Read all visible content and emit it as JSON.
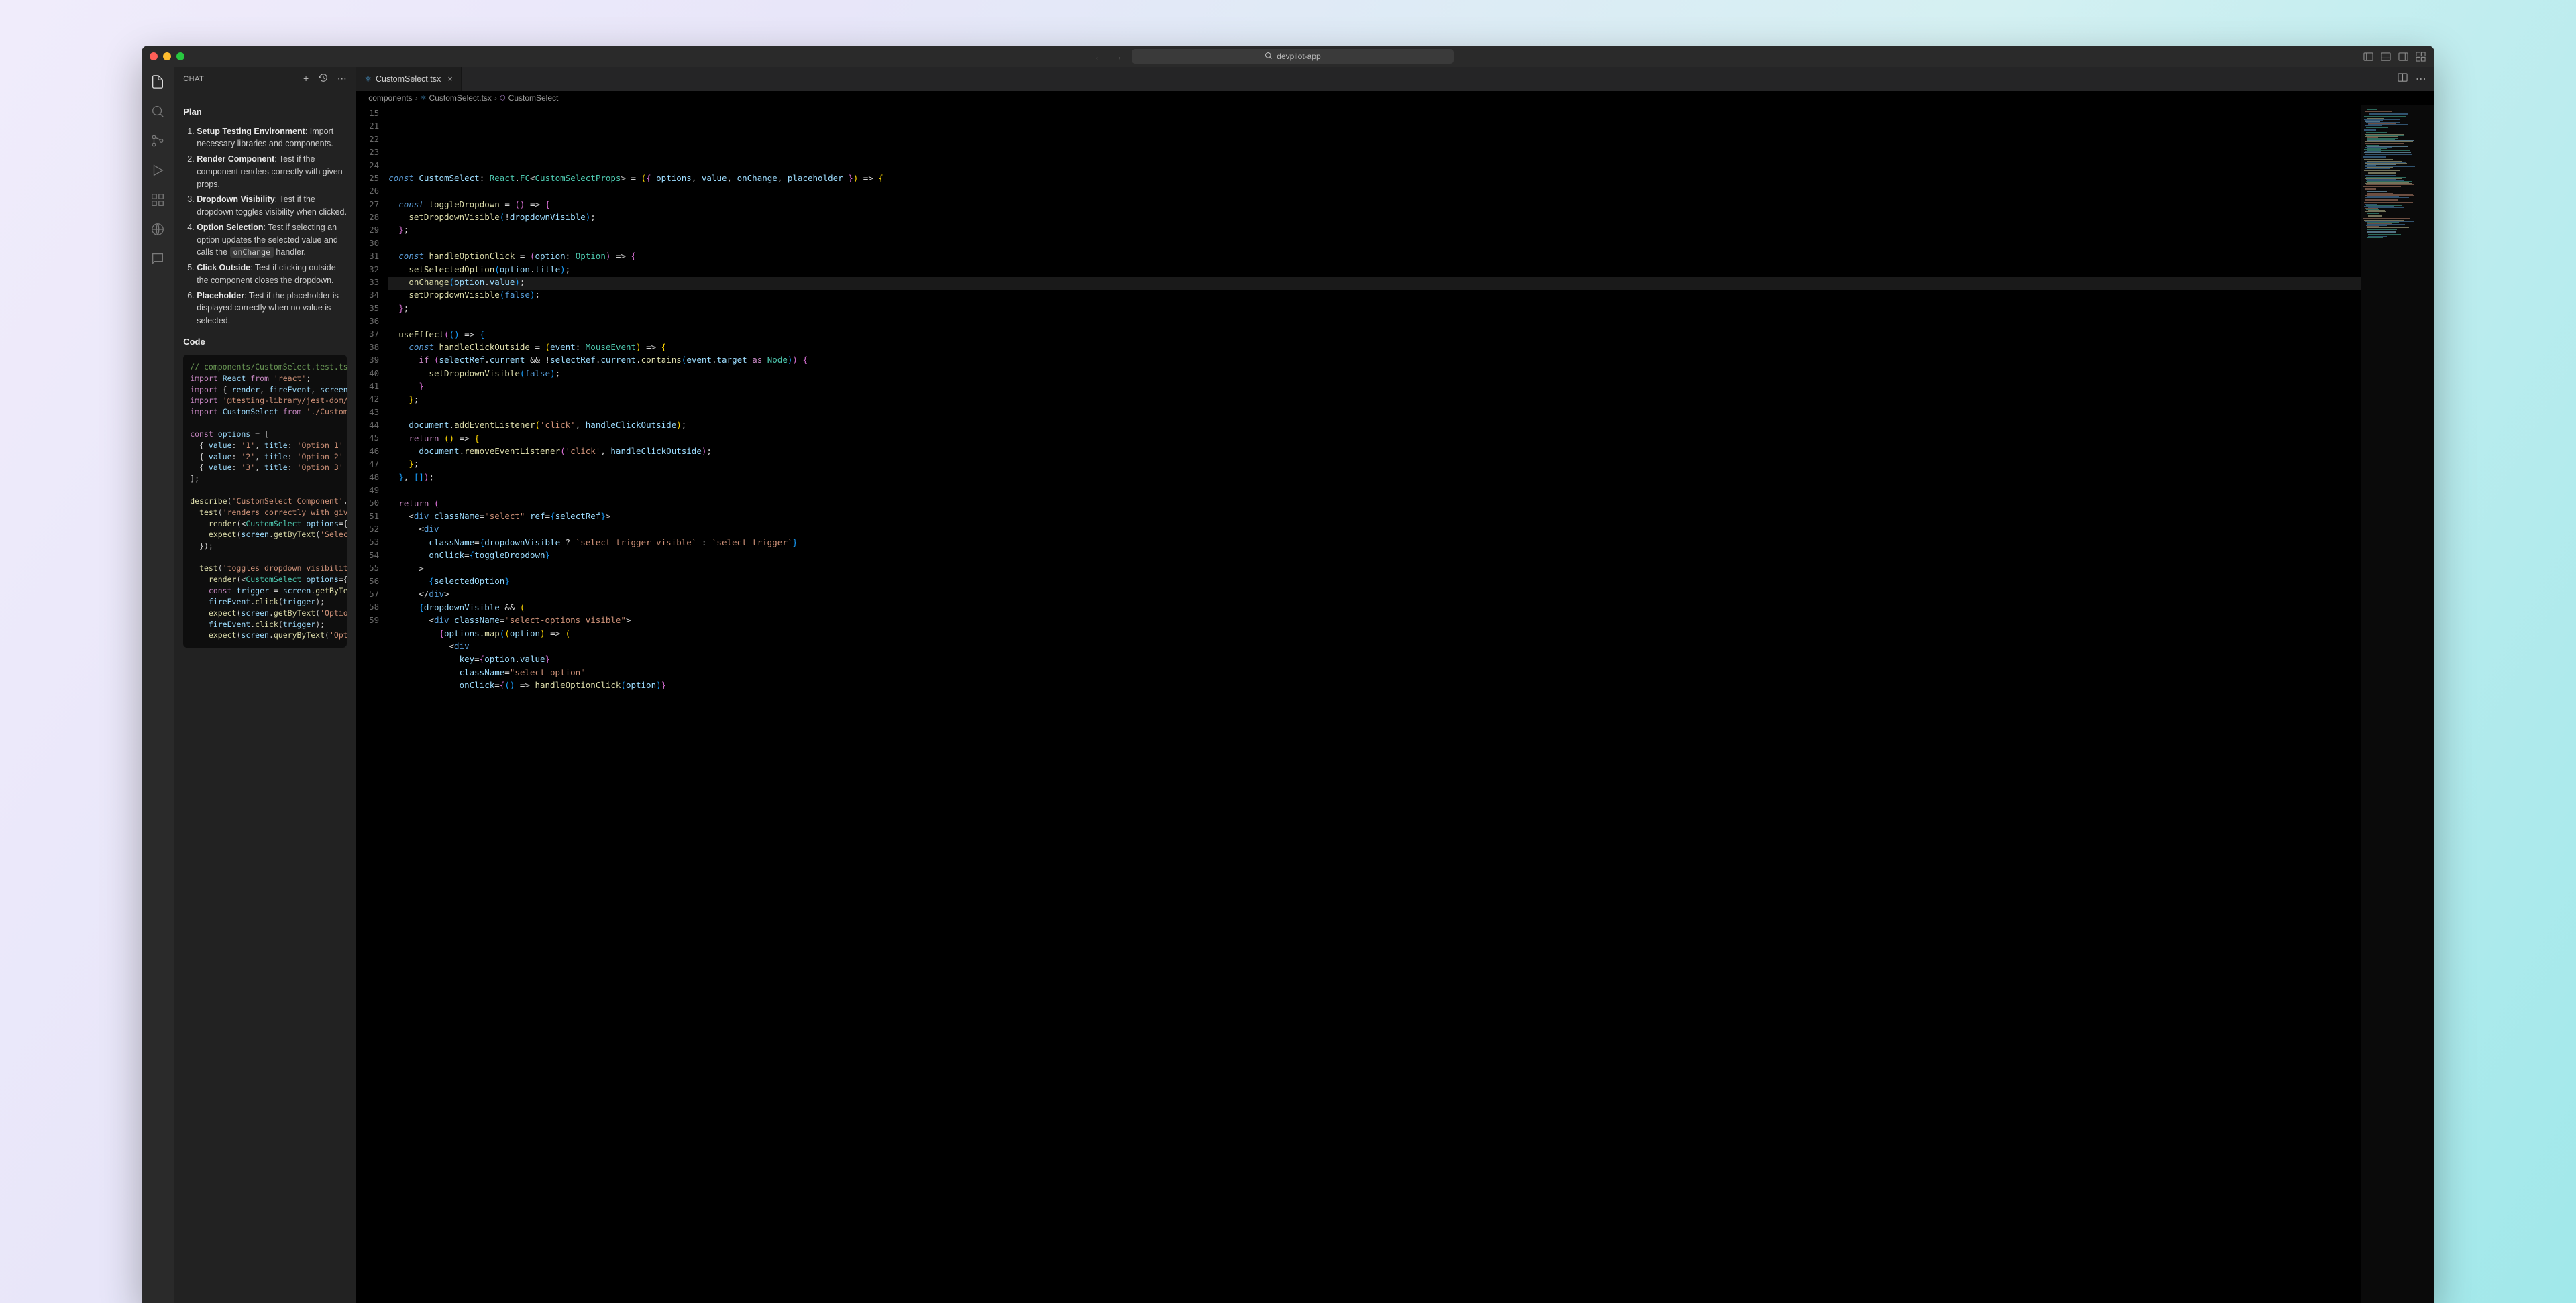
{
  "titlebar": {
    "app_name": "devpilot-app"
  },
  "sidebar": {
    "title": "CHAT",
    "sections": {
      "plan_title": "Plan",
      "code_title": "Code",
      "plan_items": [
        {
          "title": "Setup Testing Environment",
          "desc": ": Import necessary libraries and components."
        },
        {
          "title": "Render Component",
          "desc": ": Test if the component renders correctly with given props."
        },
        {
          "title": "Dropdown Visibility",
          "desc": ": Test if the dropdown toggles visibility when clicked."
        },
        {
          "title": "Option Selection",
          "desc_pre": ": Test if selecting an option updates the selected value and calls the ",
          "code": "onChange",
          "desc_post": " handler."
        },
        {
          "title": "Click Outside",
          "desc": ": Test if clicking outside the component closes the dropdown."
        },
        {
          "title": "Placeholder",
          "desc": ": Test if the placeholder is displayed correctly when no value is selected."
        }
      ]
    }
  },
  "editor": {
    "tab_name": "CustomSelect.tsx",
    "breadcrumb": {
      "folder": "components",
      "file": "CustomSelect.tsx",
      "symbol": "CustomSelect"
    },
    "first_line": 15
  }
}
